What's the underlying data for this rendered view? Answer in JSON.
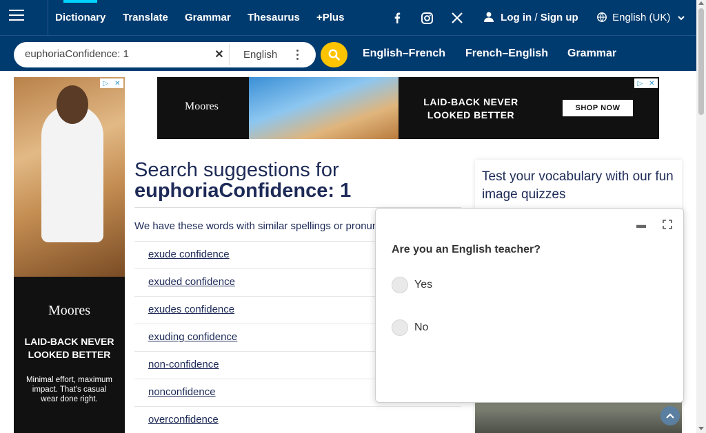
{
  "nav": {
    "links": [
      "Dictionary",
      "Translate",
      "Grammar",
      "Thesaurus",
      "+Plus"
    ],
    "active": "Dictionary",
    "social_icons": [
      "facebook-icon",
      "instagram-icon",
      "x-twitter-icon"
    ],
    "login": "Log in",
    "separator": "/",
    "signup": "Sign up",
    "language": "English (UK)"
  },
  "search": {
    "value": "euphoriaConfidence: 1",
    "dictionary": "English",
    "quick_links": [
      "English–French",
      "French–English",
      "Grammar"
    ]
  },
  "ad_left": {
    "brand": "Moores",
    "headline": "LAID-BACK NEVER LOOKED BETTER",
    "subtext": "Minimal effort, maximum impact. That's casual wear done right."
  },
  "ad_top": {
    "brand": "Moores",
    "headline_line1": "LAID-BACK NEVER",
    "headline_line2": "LOOKED BETTER",
    "cta": "SHOP NOW"
  },
  "main": {
    "title_prefix": "Search suggestions for",
    "query": "euphoriaConfidence: 1",
    "intro": "We have these words with similar spellings or pronunciations:",
    "suggestions": [
      "exude confidence",
      "exuded confidence",
      "exudes confidence",
      "exuding confidence",
      "non-confidence",
      "nonconfidence",
      "overconfidence"
    ]
  },
  "quiz": {
    "title": "Test your vocabulary with our fun image quizzes"
  },
  "popup": {
    "question": "Are you an English teacher?",
    "options": [
      "Yes",
      "No"
    ]
  },
  "colors": {
    "nav_bg": "#003b6f",
    "accent_yellow": "#fec400",
    "active_indicator": "#00d4ff",
    "text_navy": "#1d2a57"
  }
}
